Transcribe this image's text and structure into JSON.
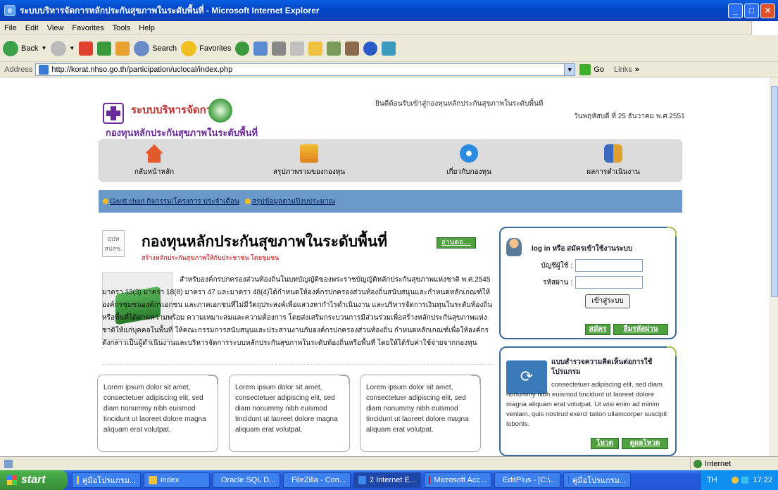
{
  "window": {
    "title": "ระบบบริหารจัดการหลักประกันสุขภาพในระดับพื้นที่ - Microsoft Internet Explorer"
  },
  "menu": [
    "File",
    "Edit",
    "View",
    "Favorites",
    "Tools",
    "Help"
  ],
  "toolbar": {
    "back": "Back",
    "search": "Search",
    "favorites": "Favorites"
  },
  "address": {
    "label": "Address",
    "url": "http://korat.nhso.go.th/participation/uclocal/index.php",
    "go": "Go",
    "links": "Links"
  },
  "header": {
    "logo_line1": "ระบบบริหารจัดการ",
    "logo_line2": "กองทุนหลักประกันสุขภาพในระดับพื้นที่",
    "welcome": "ยินดีต้อนรับเข้าสู่กองทุนหลักประกันสุขภาพในระดับพื้นที่",
    "date": "วันพฤหัสบดี ที่ 25 ธันวาคม พ.ศ.2551"
  },
  "nav": [
    {
      "label": "กลับหน้าหลัก",
      "icon": "home-icon",
      "color": "#e05a2a"
    },
    {
      "label": "สรุปภาพรวมของกองทุน",
      "icon": "chart-icon",
      "color": "#e0a020"
    },
    {
      "label": "เกี่ยวกับกองทุน",
      "icon": "gear-icon",
      "color": "#2a8ae0"
    },
    {
      "label": "ผลการดำเนินงาน",
      "icon": "users-icon",
      "color": "#3a6ac0"
    }
  ],
  "quicklinks": [
    "Gantt chart กิจกรรม/โครงการ ประจำเดือน",
    "สรุปข้อมูลตามปีงบประมาณ"
  ],
  "article": {
    "tag1": "อปท",
    "tag2": "สปสช.",
    "title": "กองทุนหลักประกันสุขภาพในระดับพื้นที่",
    "subtitle": "สร้างหลักประกันสุขภาพให้กับประชาชน โดยชุมชน",
    "readmore": "อ่านต่อ....",
    "body": "สำหรับองค์กรปกครองส่วนท้องถิ่นในบทบัญญัติของพระราชบัญญัติหลักประกันสุขภาพแห่งชาติ พ.ศ.2545 มาตรา 13(3) มาตรา 18(8) มาตรา 47 และมาตรา 48(4)ได้กำหนดให้องค์กรปกครองส่วนท้องถิ่นสนับสนุนและกำหนดหลักเกณฑ์ให้องค์กรชุมชนองค์กรเอกชน และภาคเอกชนที่ไม่มีวัตถุประสงค์เพื่อแสวงหากำไรดำเนินงาน และบริหารจัดการเงินทุนในระดับท้องถิ่นหรือพื้นที่ได้ตามความพร้อม ความเหมาะสมและความต้องการ โดยส่งเสริมกระบวนการมีส่วนร่วมเพื่อสร้างหลักประกันสุขภาพแห่งชาติให้แก่บุคคลในพื้นที่ ให้คณะกรรมการสนับสนุนและประสานงานกับองค์กรปกครองส่วนท้องถิ่น กำหนดหลักเกณฑ์เพื่อให้องค์กรดังกล่าวเป็นผู้ดำเนินงานและบริหารจัดการระบบหลักประกันสุขภาพในระดับท้องถิ่นหรือพื้นที่ โดยให้ได้รับค่าใช้จ่ายจากกองทุน"
  },
  "cards": [
    "Lorem ipsum dolor sit amet, consectetuer adipiscing elit, sed diam nonummy nibh euismod tincidunt ut laoreet dolore magna aliquam erat volutpat.",
    "Lorem ipsum dolor sit amet, consectetuer adipiscing elit, sed diam nonummy nibh euismod tincidunt ut laoreet dolore magna aliquam erat volutpat.",
    "Lorem ipsum dolor sit amet, consectetuer adipiscing elit, sed diam nonummy nibh euismod tincidunt ut laoreet dolore magna aliquam erat volutpat."
  ],
  "login": {
    "heading": "log in หรือ สมัครเข้าใช้งานระบบ",
    "user_label": "บัญชีผู้ใช้ :",
    "pass_label": "รหัสผ่าน :",
    "submit": "เข้าสู่ระบบ",
    "register": "สมัคร",
    "forgot": "ลืมรหัสผ่าน"
  },
  "poll": {
    "title": "แบบสำรวจความคิดเห็นต่อการใช้โปรแกรม",
    "text": "consectetuer adipiscing elit, sed diam nonummy nibh euismod tincidunt ut laoreet dolore magna aliquam erat volutpat. Ut wisi enim ad minim veniam, quis nostrud exerci tation ullamcorper suscipit lobortis.",
    "vote": "โหวต",
    "results": "ดูผลโหวต"
  },
  "status": {
    "zone": "Internet"
  },
  "taskbar": {
    "start": "start",
    "tasks": [
      {
        "label": "คู่มือโปรแกรม...",
        "color": "#f0c040"
      },
      {
        "label": "index",
        "color": "#f0c040"
      },
      {
        "label": "Oracle SQL D...",
        "color": "#999"
      },
      {
        "label": "FileZilla - Con...",
        "color": "#d03020"
      },
      {
        "label": "2 Internet E...",
        "color": "#3a8af0"
      },
      {
        "label": "Microsoft Acc...",
        "color": "#b02030"
      },
      {
        "label": "EditPlus - [C:\\...",
        "color": "#d02020"
      },
      {
        "label": "คู่มือโปรแกรม...",
        "color": "#2a5ab8"
      }
    ],
    "lang": "TH",
    "clock": "17:22"
  }
}
